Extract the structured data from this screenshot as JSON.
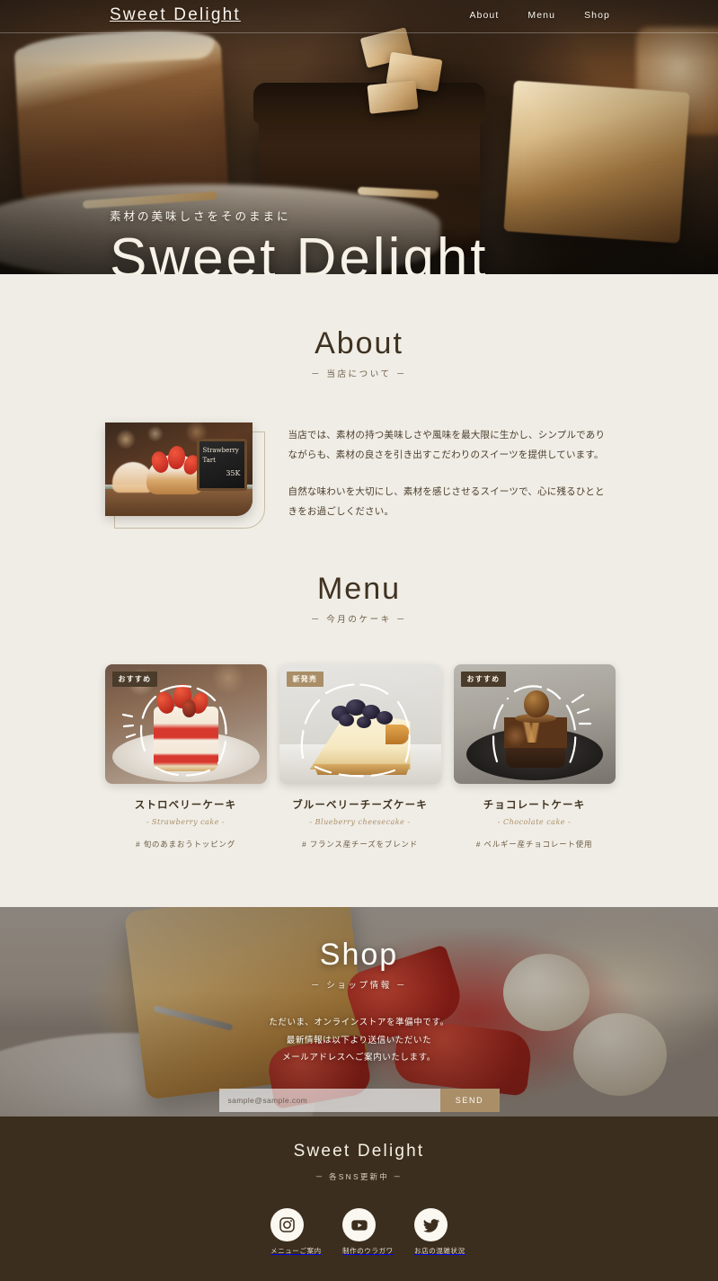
{
  "site": {
    "brand": "Sweet Delight"
  },
  "nav": {
    "items": [
      {
        "label": "About"
      },
      {
        "label": "Menu"
      },
      {
        "label": "Shop"
      }
    ]
  },
  "hero": {
    "subtitle": "素材の美味しさをそのままに",
    "title": "Sweet Delight"
  },
  "about": {
    "title": "About",
    "subtitle": "－ 当店について －",
    "image": {
      "sign_line1": "Strawberry",
      "sign_line2": "Tart",
      "sign_price": "35K"
    },
    "paragraphs": [
      "当店では、素材の持つ美味しさや風味を最大限に生かし、シンプルでありながらも、素材の良さを引き出すこだわりのスイーツを提供しています。",
      "自然な味わいを大切にし、素材を感じさせるスイーツで、心に残るひとときをお過ごしください。"
    ]
  },
  "menu": {
    "title": "Menu",
    "subtitle": "－ 今月のケーキ －",
    "cards": [
      {
        "badge": "おすすめ",
        "badge_style": "dark",
        "name": "ストロベリーケーキ",
        "en": "- Strawberry cake -",
        "tag": "# 旬のあまおうトッピング"
      },
      {
        "badge": "新発売",
        "badge_style": "tan",
        "name": "ブルーベリーチーズケーキ",
        "en": "- Blueberry cheesecake -",
        "tag": "# フランス産チーズをブレンド"
      },
      {
        "badge": "おすすめ",
        "badge_style": "dark",
        "name": "チョコレートケーキ",
        "en": "- Chocolate cake -",
        "tag": "# ベルギー産チョコレート使用"
      }
    ]
  },
  "shop": {
    "title": "Shop",
    "subtitle": "－ ショップ情報 －",
    "lead_line1": "ただいま、オンラインストアを準備中です。",
    "lead_line2": "最新情報は以下より送信いただいた",
    "lead_line3": "メールアドレスへご案内いたします。",
    "email_placeholder": "sample@sample.com",
    "email_value": "",
    "send_label": "SEND"
  },
  "footer": {
    "brand": "Sweet Delight",
    "subtitle": "－ 各SNS更新中 －",
    "socials": [
      {
        "icon": "instagram-icon",
        "label": "メニューご案内"
      },
      {
        "icon": "youtube-icon",
        "label": "制作のウラガワ"
      },
      {
        "icon": "twitter-icon",
        "label": "お店の混雑状況"
      }
    ]
  },
  "colors": {
    "page_bg": "#F0EDE6",
    "text_dark": "#3F3221",
    "accent_tan": "#A98E68",
    "footer_bg": "#3B2E1E",
    "cream": "#FBF8F1"
  }
}
